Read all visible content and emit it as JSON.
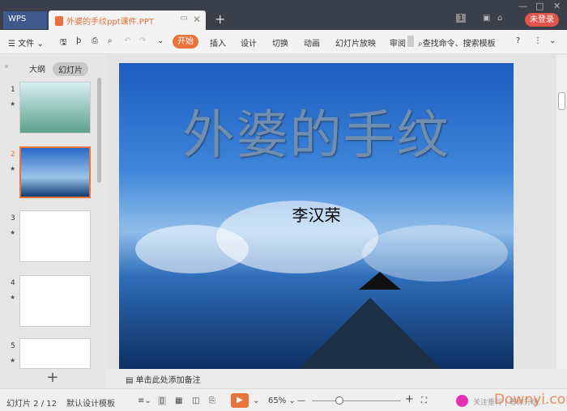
{
  "titlebar": {
    "wps": "WPS",
    "doc_tab": "外婆的手纹ppt课件.PPT",
    "new_tab": "+",
    "login": "未登录",
    "page_badge": "1"
  },
  "menu": {
    "file": "文件",
    "items": [
      "开始",
      "插入",
      "设计",
      "切换",
      "动画",
      "幻灯片放映",
      "审阅"
    ],
    "search": "查找命令、搜索模板",
    "help": "?"
  },
  "panel": {
    "tabs": [
      "大纲",
      "幻灯片"
    ],
    "slides": [
      "1",
      "2",
      "3",
      "4",
      "5"
    ],
    "selected": 2,
    "add": "+"
  },
  "slide": {
    "title": "外婆的手纹",
    "author": "李汉荣"
  },
  "notes": {
    "placeholder": "单击此处添加备注"
  },
  "status": {
    "slide_count": "幻灯片 2 / 12",
    "template": "默认设计模板",
    "zoom": "65%",
    "zoom_level": 65,
    "ad_text": "关注垂行 | 等你升级...",
    "watermark": "Downyi.com"
  },
  "colors": {
    "accent": "#e8733d",
    "titlebar": "#3a3f4b",
    "login": "#e0544a"
  }
}
